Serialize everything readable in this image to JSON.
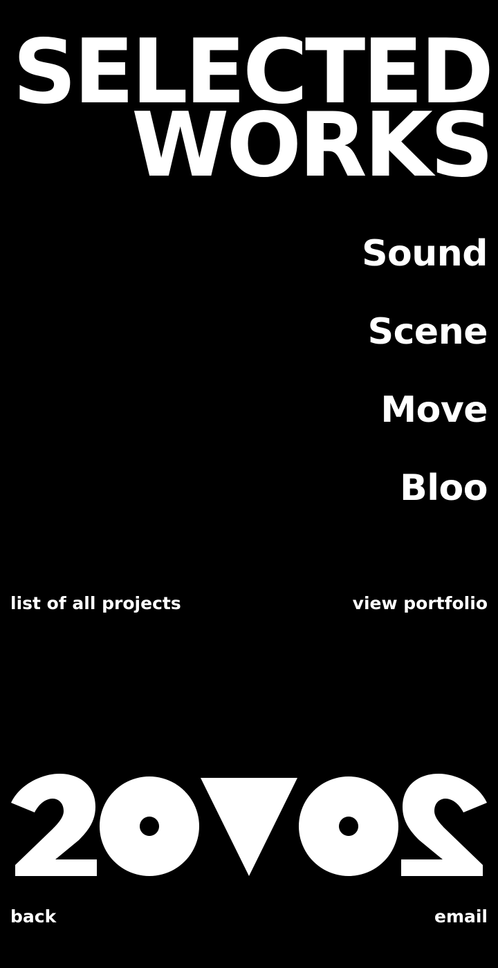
{
  "heading": {
    "line1": "SELECTED",
    "line2": "WORKS"
  },
  "projects": [
    {
      "label": "Sound"
    },
    {
      "label": "Scene"
    },
    {
      "label": "Move"
    },
    {
      "label": "Bloo"
    }
  ],
  "links": {
    "all_projects": "list of all projects",
    "portfolio": "view portfolio"
  },
  "logo": {
    "glyphs": "2OVO2",
    "icon": "mirrored-2ov02-logo"
  },
  "footer": {
    "back": "back",
    "email": "email"
  },
  "colors": {
    "background": "#000000",
    "foreground": "#ffffff"
  }
}
